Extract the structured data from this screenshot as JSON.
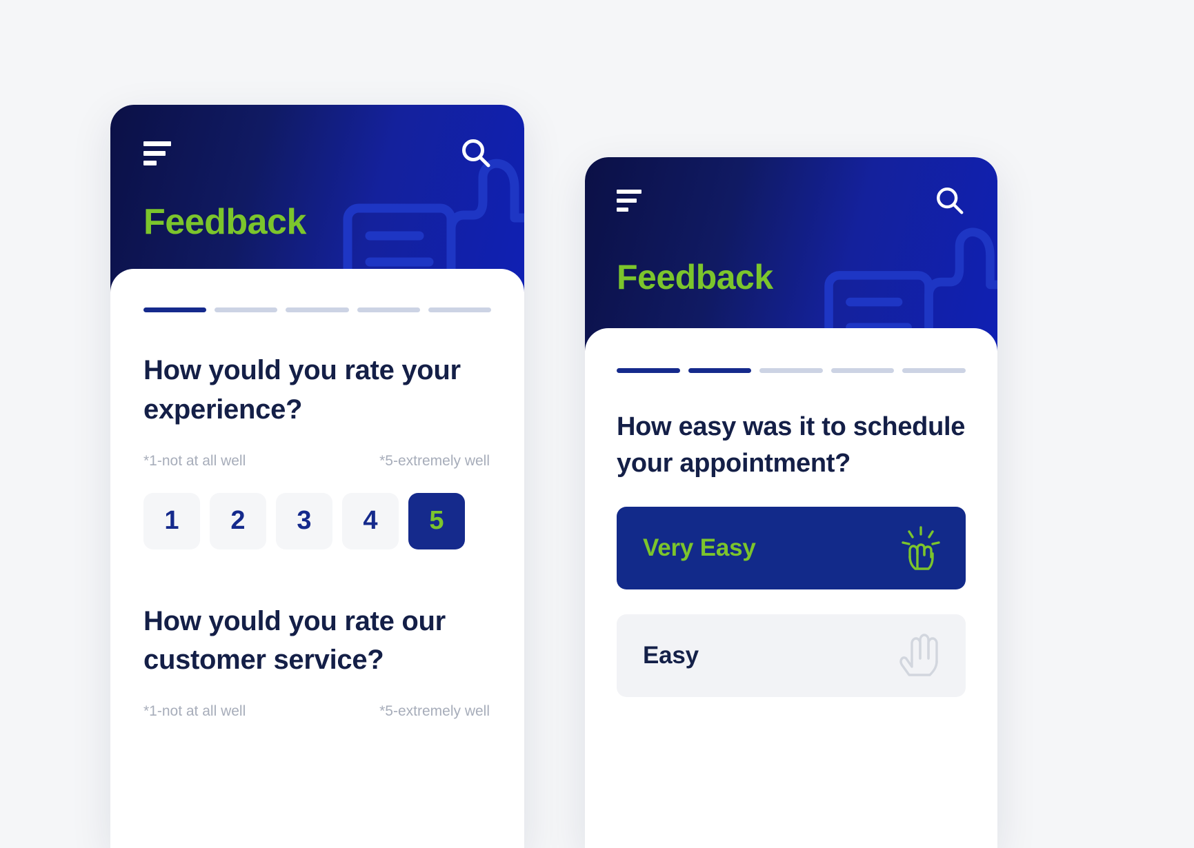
{
  "theme": {
    "brand_navy": "#152a8c",
    "brand_deep": "#0b1046",
    "brand_green": "#7cc52c",
    "text_dark": "#141f47",
    "muted_gray": "#a7adba",
    "tile_bg": "#f5f6f8",
    "page_bg": "#f5f6f8",
    "progress_off": "#ccd3e4"
  },
  "screen_one": {
    "header": {
      "menu_icon": "hamburger-menu-icon",
      "search_icon": "search-icon",
      "title": "Feedback",
      "illustration": "thumbs-up-document-icon"
    },
    "progress": {
      "total": 5,
      "completed": 1
    },
    "question_one": {
      "text": "How yould you rate your experience?",
      "low_label": "*1-not at all well",
      "high_label": "*5-extremely well",
      "options": [
        "1",
        "2",
        "3",
        "4",
        "5"
      ],
      "selected": "5"
    },
    "question_two": {
      "text": "How yould you rate our customer service?",
      "low_label": "*1-not at all well",
      "high_label": "*5-extremely well"
    }
  },
  "screen_two": {
    "header": {
      "menu_icon": "hamburger-menu-icon",
      "search_icon": "search-icon",
      "title": "Feedback",
      "illustration": "thumbs-up-document-icon"
    },
    "progress": {
      "total": 5,
      "completed": 2
    },
    "question": {
      "text": "How easy was it to schedule your appointment?"
    },
    "options": [
      {
        "label": "Very Easy",
        "icon": "tap-hand-icon",
        "selected": true
      },
      {
        "label": "Easy",
        "icon": "open-hand-icon",
        "selected": false
      }
    ]
  }
}
